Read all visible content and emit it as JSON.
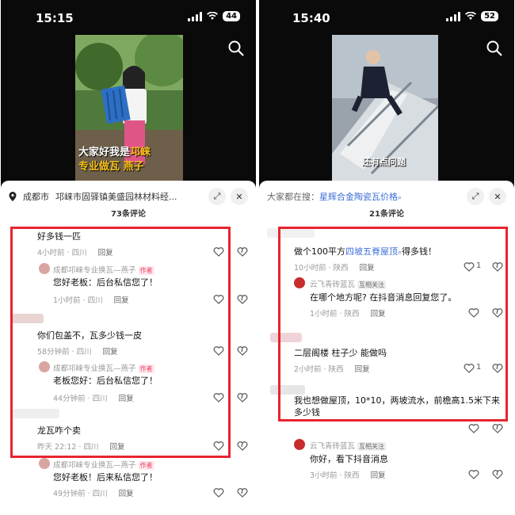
{
  "left": {
    "status_time": "15:15",
    "battery": "44",
    "subtitle_line1_white": "大家好我是",
    "subtitle_line1_yellow": "邛崃",
    "subtitle_line2": "专业做瓦 燕子",
    "location_city": "成都市",
    "location_detail": "邛崃市固驿镇美盛园林材料经...",
    "comment_count": "73条评论",
    "comments": [
      {
        "text": "好多钱一匹",
        "time": "4小时前 · 四川",
        "reply": "回复"
      },
      {
        "author": "成都邛崃专业换瓦—燕子",
        "tag": "作者",
        "text": "您好老板：后台私信您了！",
        "time": "1小时前 · 四川",
        "reply": "回复"
      },
      {
        "text": "你们包盖不，瓦多少钱一皮",
        "time": "58分钟前 · 四川",
        "reply": "回复"
      },
      {
        "author": "成都邛崃专业换瓦—燕子",
        "tag": "作者",
        "text": "老板您好：后台私信您了！",
        "time": "44分钟前 · 四川",
        "reply": "回复"
      },
      {
        "text": "龙瓦咋个卖",
        "time": "昨天 22:12 · 四川",
        "reply": "回复"
      },
      {
        "author": "成都邛崃专业换瓦—燕子",
        "tag": "作者",
        "text": "您好老板！后来私信您了！",
        "time": "49分钟前 · 四川",
        "reply": "回复"
      }
    ]
  },
  "right": {
    "status_time": "15:40",
    "battery": "52",
    "subtitle": "还有点问题",
    "search_prefix": "大家都在搜：",
    "search_term": "星辉合金陶瓷瓦价格",
    "comment_count": "21条评论",
    "comments": [
      {
        "text_a": "做个100平方",
        "text_link": "四坡五脊屋顶",
        "text_b": "得多钱！",
        "time": "10小时前 · 陕西",
        "reply": "回复",
        "likes": "1"
      },
      {
        "author": "云飞青砖蓝瓦",
        "tag": "互相关注",
        "text": "在哪个地方呢? 在抖音消息回复您了。",
        "time": "1小时前 · 陕西",
        "reply": "回复"
      },
      {
        "text": "二层阁楼 柱子少 能做吗",
        "time": "2小时前 · 陕西",
        "reply": "回复",
        "likes": "1"
      },
      {
        "text": "我也想做屋顶，10*10，两坡流水，前檐高1.5米下来多少钱",
        "time": "",
        "reply": ""
      },
      {
        "author": "云飞青砖蓝瓦",
        "tag": "互相关注",
        "text": "你好，看下抖音消息",
        "time": "3小时前 · 陕西",
        "reply": "回复"
      }
    ]
  },
  "colors": {
    "highlight_box": "#e8242f",
    "author_tag": "#f03f64",
    "link": "#3a6ed6"
  }
}
